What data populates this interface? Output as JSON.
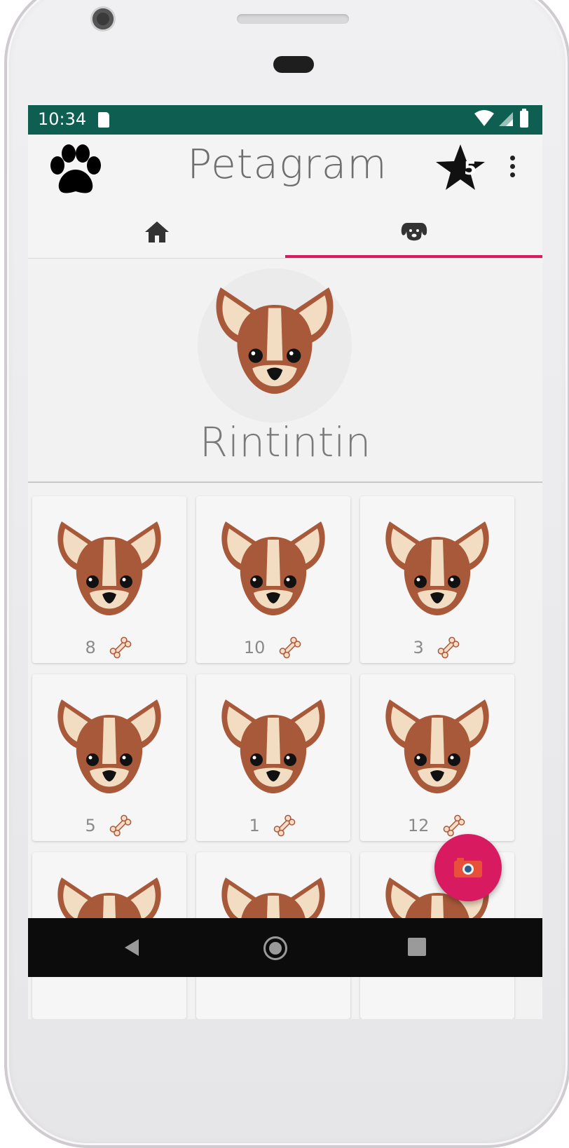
{
  "status_bar": {
    "time": "10:34"
  },
  "app_bar": {
    "title": "Petagram",
    "favorites_count": "5"
  },
  "tabs": [
    {
      "name": "home",
      "icon": "home-icon",
      "selected": false
    },
    {
      "name": "pet-profile",
      "icon": "dog-icon",
      "selected": true
    }
  ],
  "profile": {
    "name": "Rintintin"
  },
  "photos": [
    {
      "likes": "8"
    },
    {
      "likes": "10"
    },
    {
      "likes": "3"
    },
    {
      "likes": "5"
    },
    {
      "likes": "1"
    },
    {
      "likes": "12"
    },
    {
      "likes": ""
    },
    {
      "likes": ""
    },
    {
      "likes": ""
    }
  ],
  "colors": {
    "status_bar": "#0e5e51",
    "accent": "#d81b60",
    "dog_brown": "#a8593a",
    "dog_cream": "#f3ddc2"
  }
}
